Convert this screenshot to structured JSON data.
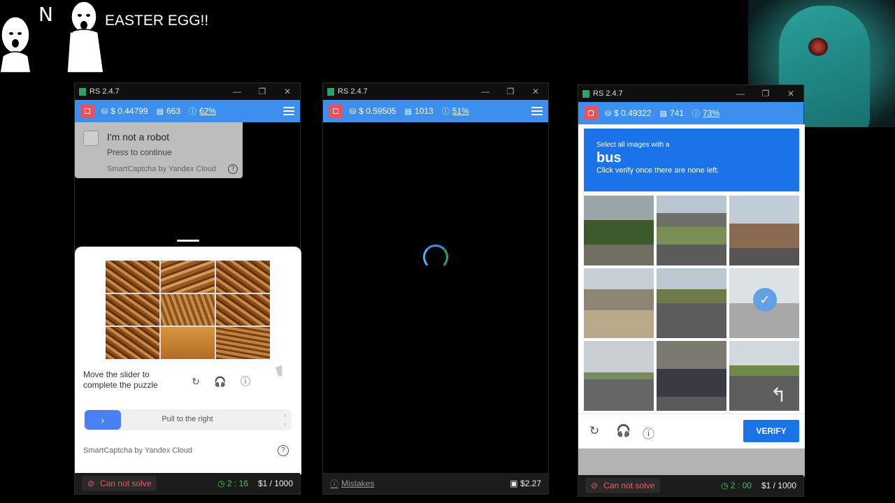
{
  "overlay": {
    "letter": "N",
    "caption": "EASTER EGG!!"
  },
  "windows": [
    {
      "title": "RS 2.4.7",
      "balance": "$ 0.44799",
      "count": "663",
      "percent": "62%",
      "robot": {
        "title": "I'm not a robot",
        "subtitle": "Press to continue",
        "brand": "SmartCaptcha by Yandex Cloud"
      },
      "puzzle": {
        "instruction": "Move the slider to complete the puzzle",
        "slider_text": "Pull to the right",
        "brand": "SmartCaptcha by Yandex Cloud"
      },
      "status": {
        "cant_solve": "Can not solve",
        "timer": "2 : 16",
        "quota": "$1 / 1000"
      }
    },
    {
      "title": "RS 2.4.7",
      "balance": "$ 0.59505",
      "count": "1013",
      "percent": "51%",
      "status": {
        "mistakes": "Mistakes",
        "wallet": "$2.27"
      }
    },
    {
      "title": "RS 2.4.7",
      "balance": "$ 0.49322",
      "count": "741",
      "percent": "73%",
      "recaptcha": {
        "prompt_small": "Select all images with a",
        "prompt_big": "bus",
        "prompt_sub": "Click verify once there are none left.",
        "verify_label": "VERIFY",
        "selected_tiles": [
          6
        ]
      },
      "status": {
        "cant_solve": "Can not solve",
        "timer": "2 : 00",
        "quota": "$1 / 1000"
      }
    }
  ],
  "colors": {
    "toolbar": "#3d8ff0",
    "stop": "#e9525c",
    "cant_solve": "#f05a5a",
    "timer": "#3fc35a",
    "recaptcha_blue": "#1a73e8"
  }
}
